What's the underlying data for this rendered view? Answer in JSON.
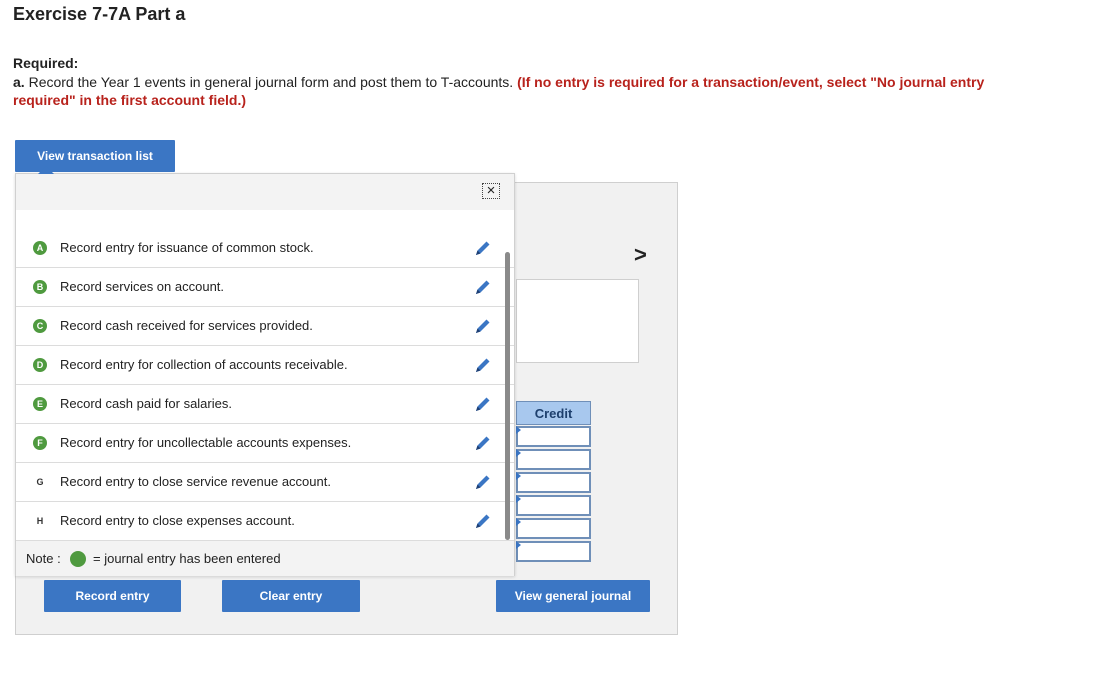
{
  "header": {
    "title": "Exercise 7-7A Part a",
    "required_label": "Required:",
    "instruction_prefix": "a.",
    "instruction_text": "Record the Year 1 events in general journal form and post them to T-accounts.",
    "instruction_red": "(If no entry is required for a transaction/event, select \"No journal entry required\" in the first account field.)"
  },
  "buttons": {
    "view_transaction_list": "View transaction list",
    "record_entry": "Record entry",
    "clear_entry": "Clear entry",
    "view_general_journal": "View general journal"
  },
  "panel": {
    "credit_header": "Credit",
    "next_chevron": ">"
  },
  "popup": {
    "close_symbol": "×",
    "transactions": [
      {
        "letter": "A",
        "text": "Record entry for issuance of common stock.",
        "entered": true
      },
      {
        "letter": "B",
        "text": "Record services on account.",
        "entered": true
      },
      {
        "letter": "C",
        "text": "Record cash received for services provided.",
        "entered": true
      },
      {
        "letter": "D",
        "text": "Record entry for collection of accounts receivable.",
        "entered": true
      },
      {
        "letter": "E",
        "text": "Record cash paid for salaries.",
        "entered": true
      },
      {
        "letter": "F",
        "text": "Record entry for uncollectable accounts expenses.",
        "entered": true
      },
      {
        "letter": "G",
        "text": "Record entry to close service revenue account.",
        "entered": false
      },
      {
        "letter": "H",
        "text": "Record entry to close expenses account.",
        "entered": false
      }
    ],
    "note_label": "Note :",
    "note_text": "= journal entry has been entered"
  },
  "colors": {
    "accent": "#3b76c4",
    "entered_badge": "#4f9a3f",
    "instruction_red": "#b8221c"
  }
}
